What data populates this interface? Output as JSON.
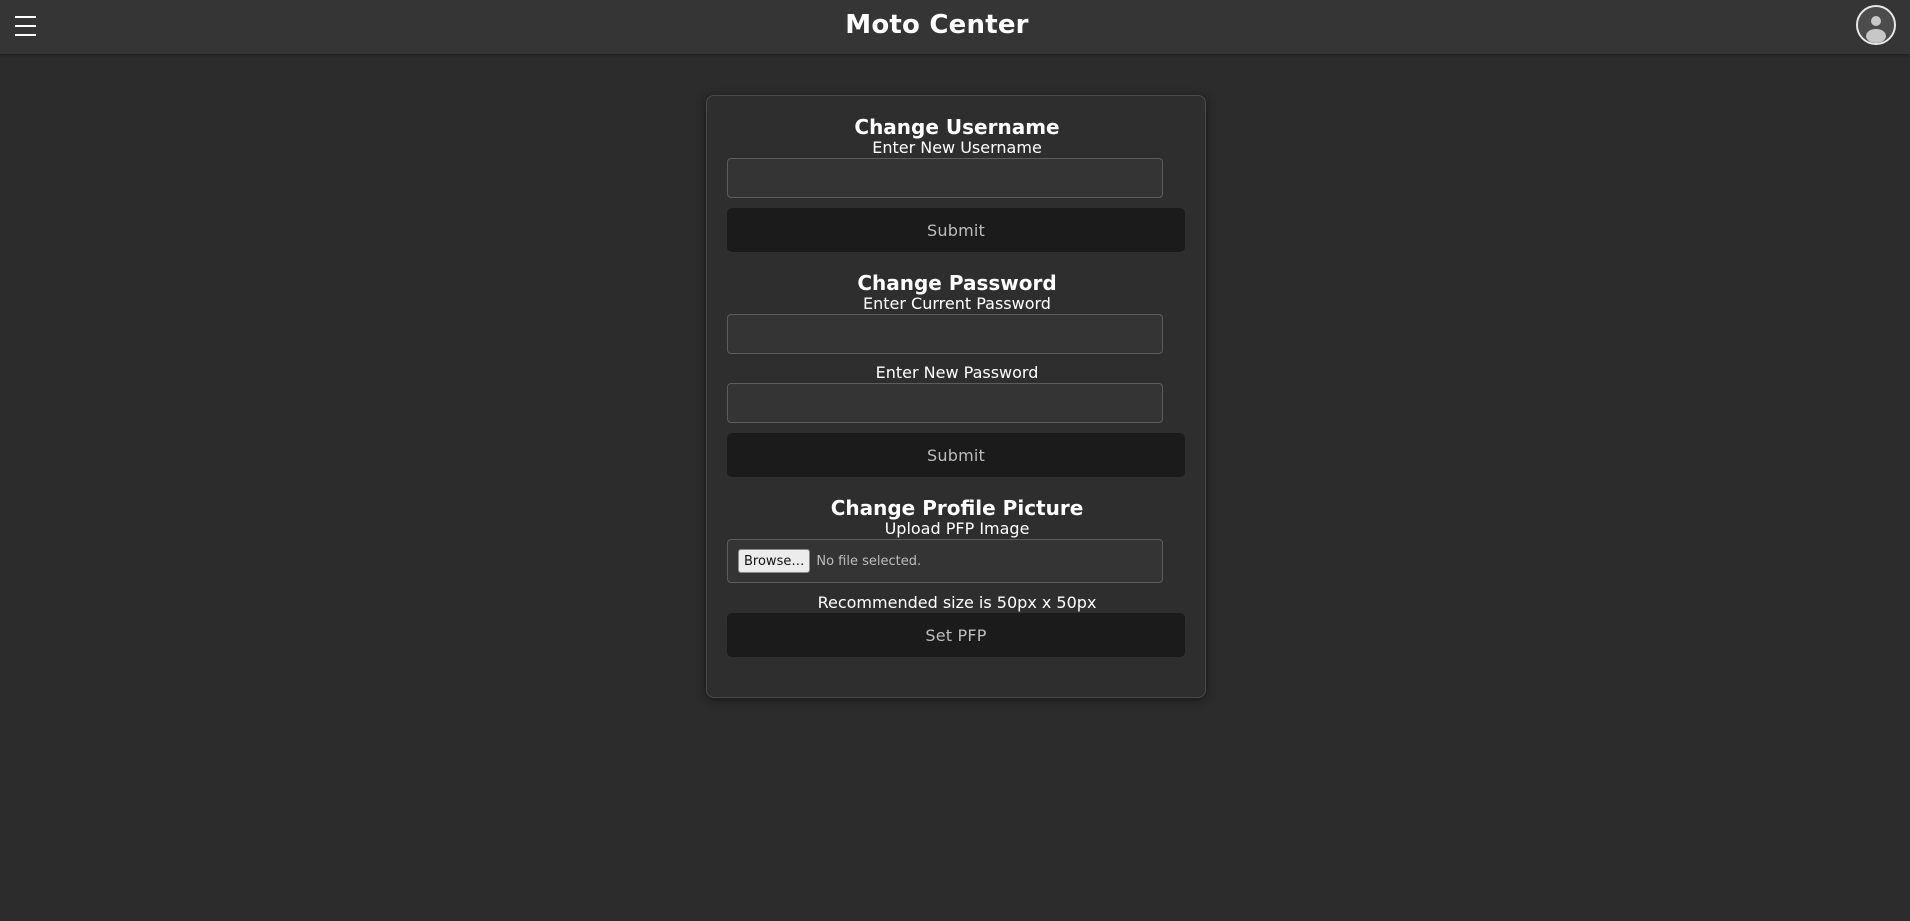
{
  "header": {
    "title": "Moto Center",
    "menu_icon": "hamburger-menu-icon",
    "avatar_icon": "user-avatar-icon"
  },
  "username_section": {
    "title": "Change Username",
    "label": "Enter New Username",
    "input_value": "",
    "submit_label": "Submit"
  },
  "password_section": {
    "title": "Change Password",
    "current_label": "Enter Current Password",
    "current_value": "",
    "new_label": "Enter New Password",
    "new_value": "",
    "submit_label": "Submit"
  },
  "pfp_section": {
    "title": "Change Profile Picture",
    "label": "Upload PFP Image",
    "browse_label": "Browse…",
    "file_status": "No file selected.",
    "hint": "Recommended size is 50px x 50px",
    "submit_label": "Set PFP"
  },
  "colors": {
    "background": "#2c2c2c",
    "topbar": "#353535",
    "card": "#2e2e2e",
    "button": "#1b1b1b"
  }
}
